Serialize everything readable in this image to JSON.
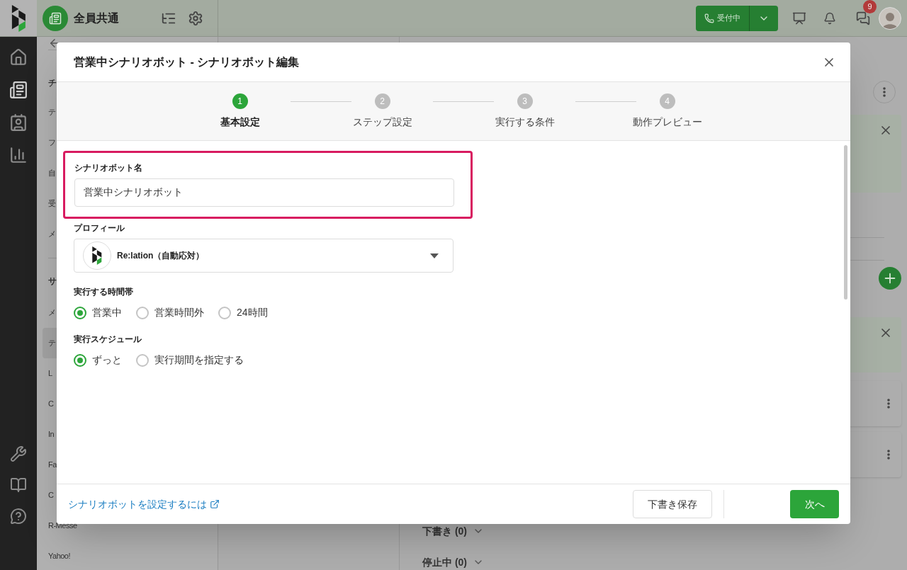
{
  "topbar": {
    "workspace": "全員共通",
    "status_button": "受付中",
    "badge": "9"
  },
  "sidebar": {
    "items": [
      {
        "label": "チ",
        "kind": "heading"
      },
      {
        "label": "テ",
        "kind": "item",
        "selected": false
      },
      {
        "label": "フ",
        "kind": "item",
        "selected": false
      },
      {
        "label": "自",
        "kind": "item",
        "selected": false
      },
      {
        "label": "受",
        "kind": "item",
        "selected": false
      },
      {
        "label": "メ",
        "kind": "item",
        "selected": false
      },
      {
        "label": "サ",
        "kind": "heading"
      },
      {
        "label": "メ",
        "kind": "item",
        "selected": false
      },
      {
        "label": "テ",
        "kind": "item",
        "selected": true
      },
      {
        "label": "L",
        "kind": "item",
        "selected": false
      },
      {
        "label": "C",
        "kind": "item",
        "selected": false
      },
      {
        "label": "In",
        "kind": "item",
        "selected": false
      },
      {
        "label": "Fa",
        "kind": "item",
        "selected": false
      },
      {
        "label": "C",
        "kind": "item",
        "selected": false
      },
      {
        "label": "R-Messe",
        "kind": "item",
        "selected": false
      },
      {
        "label": "Yahoo!",
        "kind": "item",
        "selected": false
      }
    ]
  },
  "main": {
    "sections": [
      {
        "label": "下書き (0)"
      },
      {
        "label": "停止中 (0)"
      }
    ]
  },
  "dialog": {
    "title": "営業中シナリオボット - シナリオボット編集",
    "steps": [
      {
        "number": "1",
        "label": "基本設定",
        "selected": true
      },
      {
        "number": "2",
        "label": "ステップ設定",
        "selected": false
      },
      {
        "number": "3",
        "label": "実行する条件",
        "selected": false
      },
      {
        "number": "4",
        "label": "動作プレビュー",
        "selected": false
      }
    ],
    "name_field": {
      "label": "シナリオボット名",
      "value": "営業中シナリオボット",
      "highlighted": true
    },
    "profile": {
      "label": "プロフィール",
      "value": "Re:lation（自動応対）"
    },
    "radio_groups": [
      {
        "label": "実行する時間帯",
        "options": [
          {
            "label": "営業中",
            "selected": true
          },
          {
            "label": "営業時間外",
            "selected": false
          },
          {
            "label": "24時間",
            "selected": false
          }
        ]
      },
      {
        "label": "実行スケジュール",
        "options": [
          {
            "label": "ずっと",
            "selected": true
          },
          {
            "label": "実行期間を指定する",
            "selected": false
          }
        ]
      }
    ],
    "help_link": "シナリオボットを設定するには",
    "draft_button": "下書き保存",
    "next_button": "次へ"
  }
}
